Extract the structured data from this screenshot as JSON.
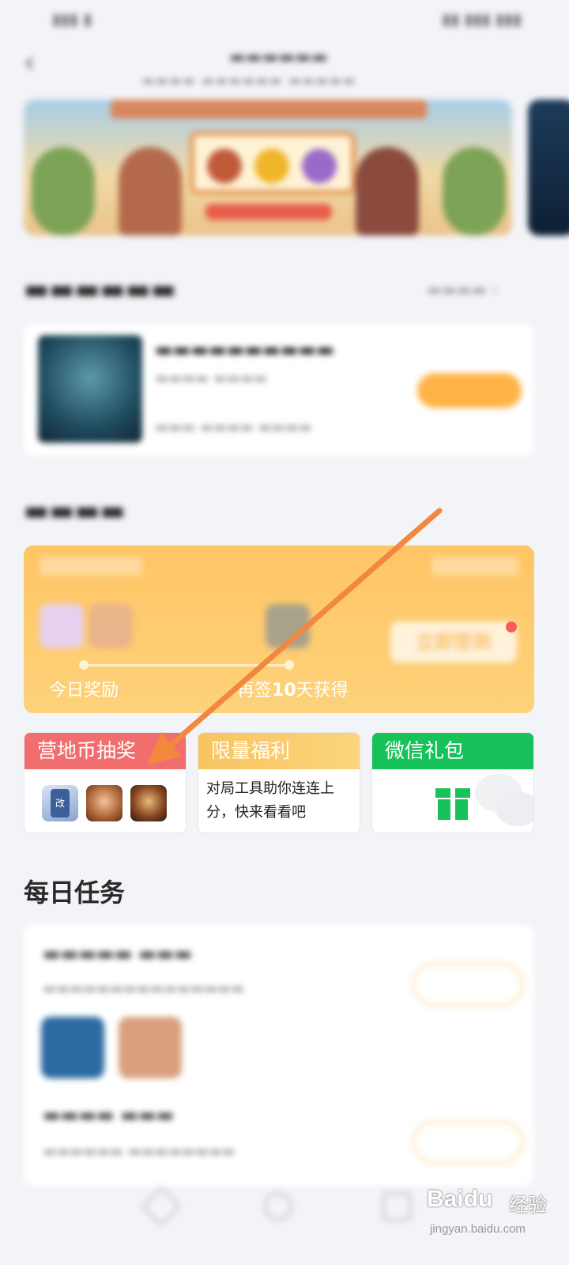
{
  "welfare": {
    "today_reward_label": "今日奖励",
    "next_reward_prefix": "再签",
    "next_reward_days": "10",
    "next_reward_suffix": "天获得",
    "sign_button_label": "立即签到"
  },
  "tiles": {
    "lottery": {
      "title": "营地币抽奖",
      "card_icon_text": "改"
    },
    "limited": {
      "title": "限量福利",
      "description": "对局工具助你连连上分，快来看看吧"
    },
    "wechat": {
      "title": "微信礼包"
    }
  },
  "tasks": {
    "section_title": "每日任务"
  },
  "colors": {
    "lottery_red": "#f26d6d",
    "limited_yellow": "#f8c45f",
    "wechat_green": "#17c25a",
    "welfare_orange": "#ffc565",
    "arrow_orange": "#f2883f"
  },
  "icons": {
    "back": "back-arrow-icon",
    "gift": "gift-icon",
    "wechat": "wechat-logo-icon",
    "pointer": "orange-arrow-annotation"
  },
  "watermark": {
    "logo": "Baidu",
    "suffix": "经验",
    "url": "jingyan.baidu.com"
  }
}
